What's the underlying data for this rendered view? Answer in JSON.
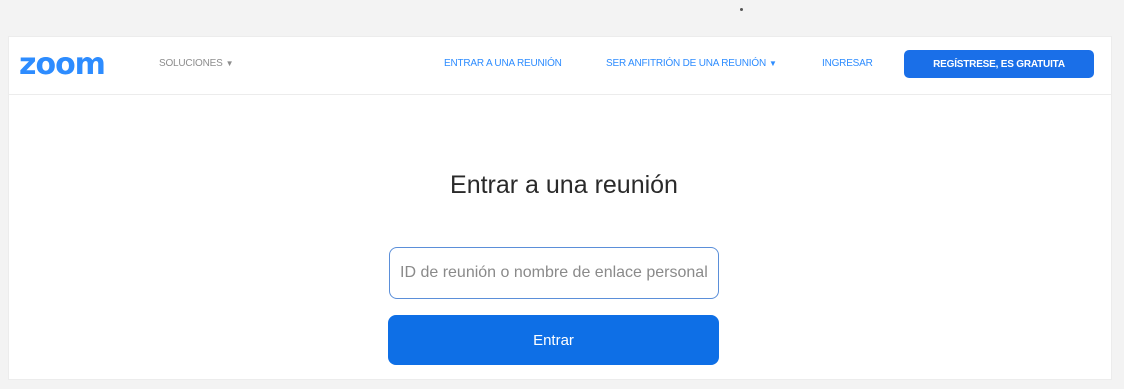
{
  "brand": {
    "logo_text": "zoom",
    "color": "#2d8cff"
  },
  "nav": {
    "solutions_label": "SOLUCIONES",
    "join_meeting_label": "ENTRAR A UNA REUNIÓN",
    "host_meeting_label": "SER ANFITRIÓN DE UNA REUNIÓN",
    "signin_label": "INGRESAR",
    "signup_label": "REGÍSTRESE, ES GRATUITA",
    "caret_icon": "chevron-down-icon"
  },
  "main": {
    "title": "Entrar a una reunión",
    "meeting_input": {
      "value": "",
      "placeholder": "ID de reunión o nombre de enlace personal"
    },
    "join_button_label": "Entrar",
    "accent_color": "#0e6fe6"
  }
}
